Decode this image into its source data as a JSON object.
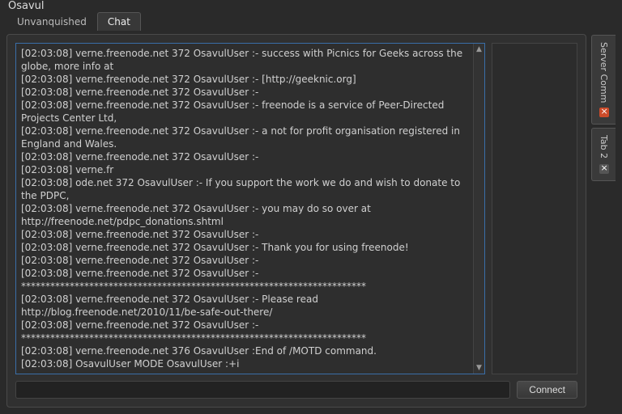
{
  "window": {
    "title": "Osavul"
  },
  "tabs": {
    "items": [
      {
        "label": "Unvanquished",
        "active": false
      },
      {
        "label": "Chat",
        "active": true
      }
    ]
  },
  "log": {
    "lines": [
      "[02:03:08] verne.freenode.net 372 OsavulUser :- success with Picnics for Geeks across the globe, more info at",
      "[02:03:08] verne.freenode.net 372 OsavulUser :- [http://geeknic.org]",
      "[02:03:08] verne.freenode.net 372 OsavulUser :-",
      "[02:03:08] verne.freenode.net 372 OsavulUser :- freenode is a service of Peer-Directed Projects Center Ltd,",
      "[02:03:08] verne.freenode.net 372 OsavulUser :- a not for profit organisation registered in England and Wales.",
      "[02:03:08] verne.freenode.net 372 OsavulUser :-",
      "[02:03:08] verne.fr",
      "[02:03:08] ode.net 372 OsavulUser :- If you support the work we do and wish to donate to the PDPC,",
      "[02:03:08] verne.freenode.net 372 OsavulUser :- you may do so over at http://freenode.net/pdpc_donations.shtml",
      "[02:03:08] verne.freenode.net 372 OsavulUser :-",
      "[02:03:08] verne.freenode.net 372 OsavulUser :- Thank you for using freenode!",
      "[02:03:08] verne.freenode.net 372 OsavulUser :-",
      "[02:03:08] verne.freenode.net 372 OsavulUser :-  ***********************************************************************",
      "[02:03:08] verne.freenode.net 372 OsavulUser :- Please read http://blog.freenode.net/2010/11/be-safe-out-there/",
      "[02:03:08] verne.freenode.net 372 OsavulUser :-  ***********************************************************************",
      "[02:03:08] verne.freenode.net 376 OsavulUser :End of /MOTD command.",
      "[02:03:08] OsavulUser MODE OsavulUser :+i"
    ]
  },
  "input": {
    "value": ""
  },
  "buttons": {
    "connect": "Connect"
  },
  "dock": {
    "items": [
      {
        "label": "Server Comm",
        "close_style": "orange"
      },
      {
        "label": "Tab 2",
        "close_style": "grey"
      }
    ]
  }
}
